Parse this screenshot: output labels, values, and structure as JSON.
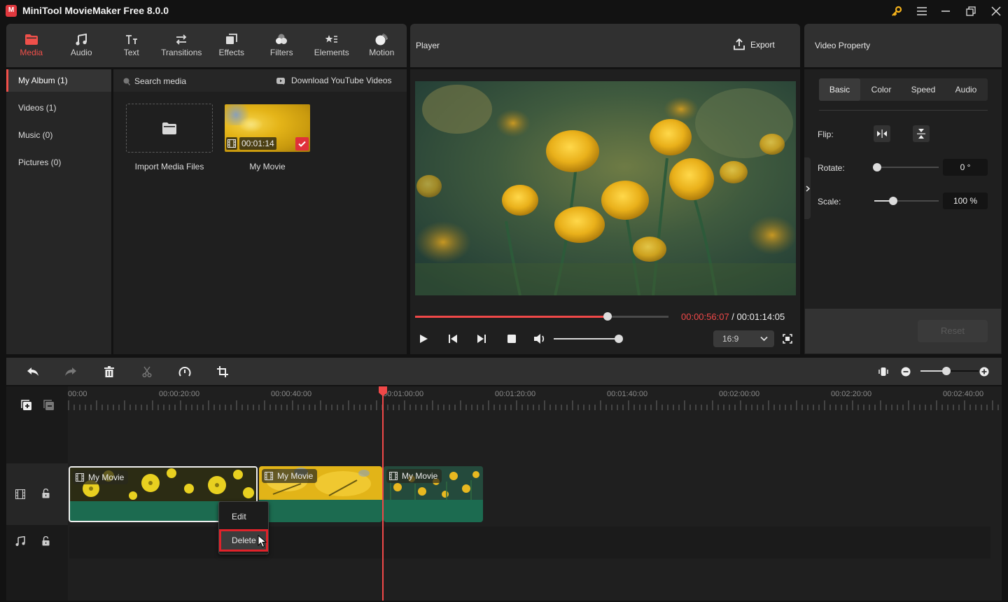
{
  "app": {
    "title": "MiniTool MovieMaker Free 8.0.0",
    "logo_glyph": "M"
  },
  "window_controls": {
    "key_icon_color": "#f5b21b",
    "items": [
      "key-icon",
      "menu-icon",
      "minimize-icon",
      "maximize-icon",
      "close-icon"
    ]
  },
  "toolbar": {
    "active": "Media",
    "accent_color": "#f0504a",
    "items": [
      {
        "label": "Media",
        "icon": "folder-icon"
      },
      {
        "label": "Audio",
        "icon": "music-note-icon"
      },
      {
        "label": "Text",
        "icon": "text-icon"
      },
      {
        "label": "Transitions",
        "icon": "transitions-icon"
      },
      {
        "label": "Effects",
        "icon": "effects-icon"
      },
      {
        "label": "Filters",
        "icon": "filters-icon"
      },
      {
        "label": "Elements",
        "icon": "elements-icon"
      },
      {
        "label": "Motion",
        "icon": "motion-icon"
      }
    ]
  },
  "sidebar": {
    "items": [
      {
        "label": "My Album (1)",
        "active": true
      },
      {
        "label": "Videos (1)",
        "active": false
      },
      {
        "label": "Music (0)",
        "active": false
      },
      {
        "label": "Pictures (0)",
        "active": false
      }
    ]
  },
  "media": {
    "search_placeholder": "Search media",
    "download_label": "Download YouTube Videos",
    "import_label": "Import Media Files",
    "items": [
      {
        "name": "My Movie",
        "duration": "00:01:14",
        "added": true
      }
    ]
  },
  "player": {
    "title": "Player",
    "export_label": "Export",
    "current_time": "00:00:56:07",
    "separator": " / ",
    "total_time": "00:01:14:05",
    "progress_fraction": 0.76,
    "volume_fraction": 1.0,
    "aspect_ratio": "16:9"
  },
  "property": {
    "title": "Video Property",
    "tabs": [
      "Basic",
      "Color",
      "Speed",
      "Audio"
    ],
    "active_tab": "Basic",
    "flip_label": "Flip:",
    "rotate_label": "Rotate:",
    "rotate_value": "0 °",
    "rotate_fraction": 0.0,
    "scale_label": "Scale:",
    "scale_value": "100 %",
    "scale_fraction": 0.29,
    "reset_label": "Reset"
  },
  "timeline": {
    "zoom_fraction": 0.44,
    "ruler_labels": [
      "00:00",
      "00:00:20:00",
      "00:00:40:00",
      "00:01:00:00",
      "00:01:20:00",
      "00:01:40:00",
      "00:02:00:00",
      "00:02:20:00",
      "00:02:40:00"
    ],
    "playhead_time": "00:00:56:07",
    "playhead_color": "#f04848",
    "clip_color": "#1c6b50",
    "clips": [
      {
        "label": "My Movie",
        "selected": true
      },
      {
        "label": "My Movie",
        "selected": false
      },
      {
        "label": "My Movie",
        "selected": false
      }
    ]
  },
  "context_menu": {
    "items": [
      {
        "label": "Edit",
        "highlighted": false
      },
      {
        "label": "Delete",
        "highlighted": true
      }
    ]
  }
}
